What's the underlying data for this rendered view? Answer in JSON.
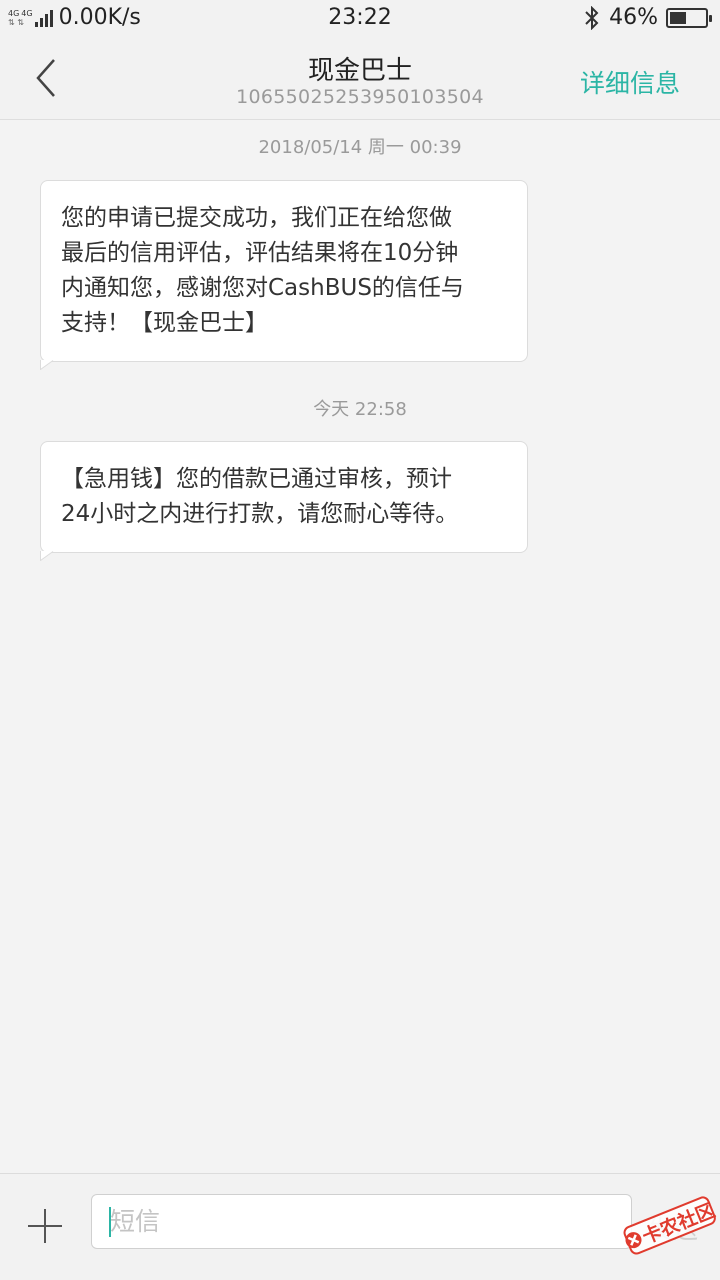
{
  "status_bar": {
    "network_badge": [
      "4G",
      "4G"
    ],
    "speed": "0.00K/s",
    "time": "23:22",
    "battery_text": "46%",
    "battery_level": 0.46,
    "icons": [
      "signal-icon",
      "bluetooth-icon",
      "battery-icon"
    ]
  },
  "header": {
    "title": "现金巴士",
    "number": "10655025253950103504",
    "details_label": "详细信息",
    "accent_color": "#2bb5a5"
  },
  "messages": [
    {
      "timestamp": "2018/05/14 周一  00:39",
      "lines": [
        "您的申请已提交成功，我们正在给您做",
        "最后的信用评估，评估结果将在10分钟",
        "内通知您，感谢您对CashBUS的信任与",
        "支持！【现金巴士】"
      ]
    },
    {
      "timestamp": "今天  22:58",
      "lines": [
        "【急用钱】您的借款已通过审核，预计",
        "24小时之内进行打款，请您耐心等待。"
      ]
    }
  ],
  "input_bar": {
    "placeholder": "短信",
    "value": "",
    "send_label": "发送"
  },
  "watermark": {
    "text": "卡农社区"
  }
}
